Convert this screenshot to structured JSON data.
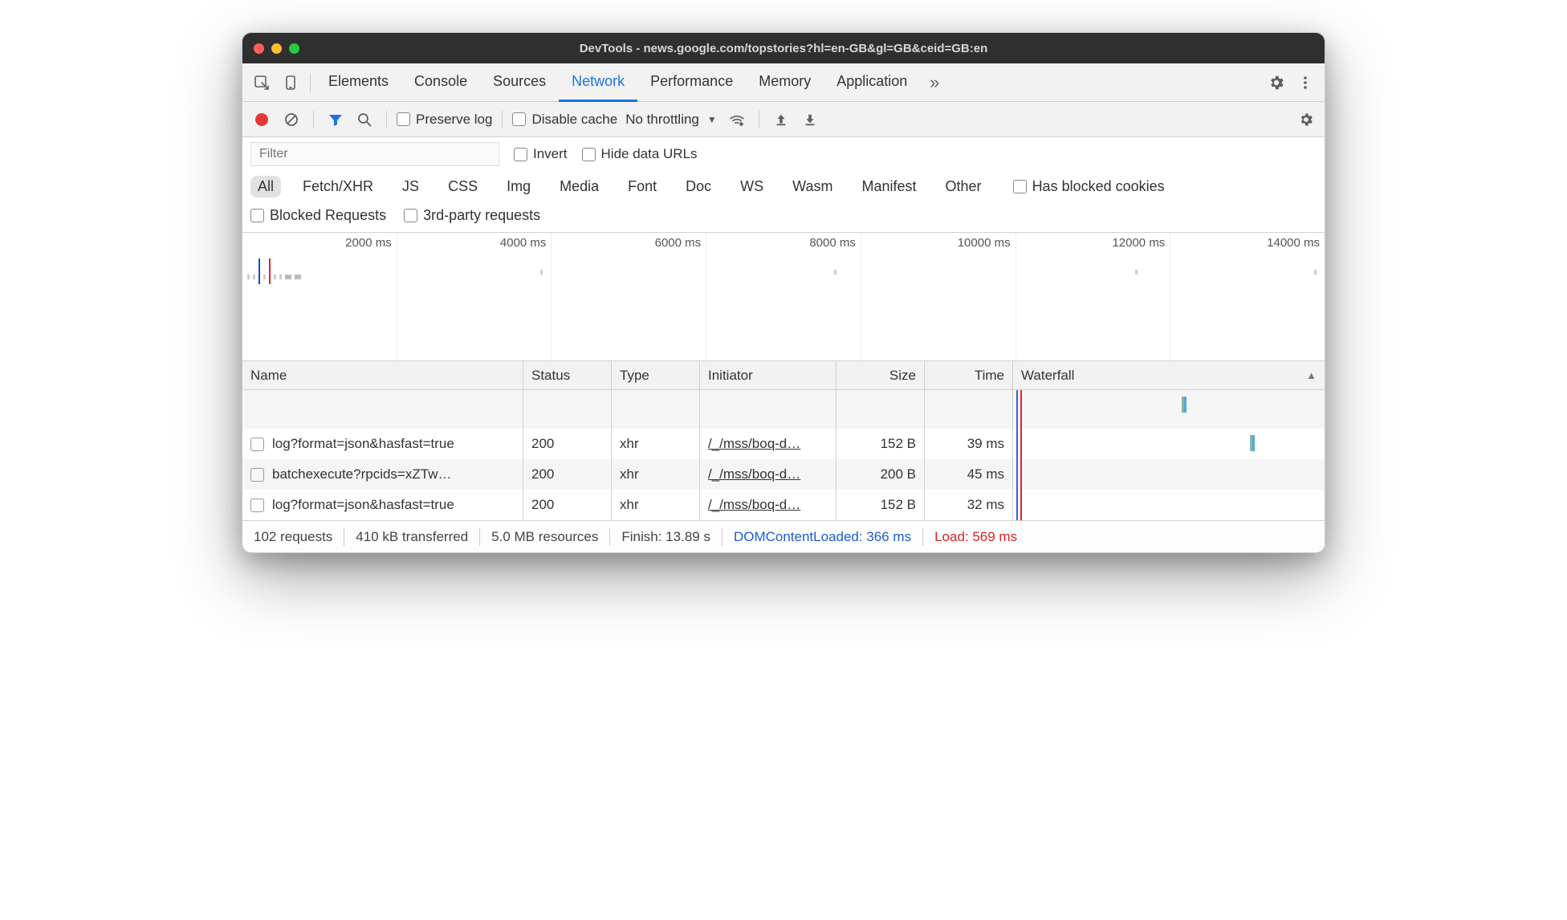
{
  "window": {
    "title": "DevTools - news.google.com/topstories?hl=en-GB&gl=GB&ceid=GB:en"
  },
  "tabs": [
    "Elements",
    "Console",
    "Sources",
    "Network",
    "Performance",
    "Memory",
    "Application"
  ],
  "active_tab": "Network",
  "toolbar": {
    "preserve_log": "Preserve log",
    "disable_cache": "Disable cache",
    "throttling": "No throttling"
  },
  "filter": {
    "placeholder": "Filter",
    "invert": "Invert",
    "hide_data_urls": "Hide data URLs",
    "types": [
      "All",
      "Fetch/XHR",
      "JS",
      "CSS",
      "Img",
      "Media",
      "Font",
      "Doc",
      "WS",
      "Wasm",
      "Manifest",
      "Other"
    ],
    "active_type": "All",
    "has_blocked_cookies": "Has blocked cookies",
    "blocked_requests": "Blocked Requests",
    "third_party": "3rd-party requests"
  },
  "timeline": {
    "ticks": [
      "2000 ms",
      "4000 ms",
      "6000 ms",
      "8000 ms",
      "10000 ms",
      "12000 ms",
      "14000 ms"
    ]
  },
  "columns": [
    "Name",
    "Status",
    "Type",
    "Initiator",
    "Size",
    "Time",
    "Waterfall"
  ],
  "rows": [
    {
      "name": "log?format=json&hasfast=true",
      "status": "200",
      "type": "xhr",
      "initiator": "/_/mss/boq-d…",
      "size": "152 B",
      "time": "39 ms",
      "wf_left": "54%"
    },
    {
      "name": "batchexecute?rpcids=xZTw…",
      "status": "200",
      "type": "xhr",
      "initiator": "/_/mss/boq-d…",
      "size": "200 B",
      "time": "45 ms",
      "wf_left": "54%"
    },
    {
      "name": "log?format=json&hasfast=true",
      "status": "200",
      "type": "xhr",
      "initiator": "/_/mss/boq-d…",
      "size": "152 B",
      "time": "32 ms",
      "wf_left": "54%"
    }
  ],
  "waterfall_extra": [
    {
      "left": "54%",
      "top_row": 0
    },
    {
      "left": "76%",
      "top_row": 1
    }
  ],
  "status": {
    "requests": "102 requests",
    "transferred": "410 kB transferred",
    "resources": "5.0 MB resources",
    "finish": "Finish: 13.89 s",
    "dcl": "DOMContentLoaded: 366 ms",
    "load": "Load: 569 ms"
  }
}
